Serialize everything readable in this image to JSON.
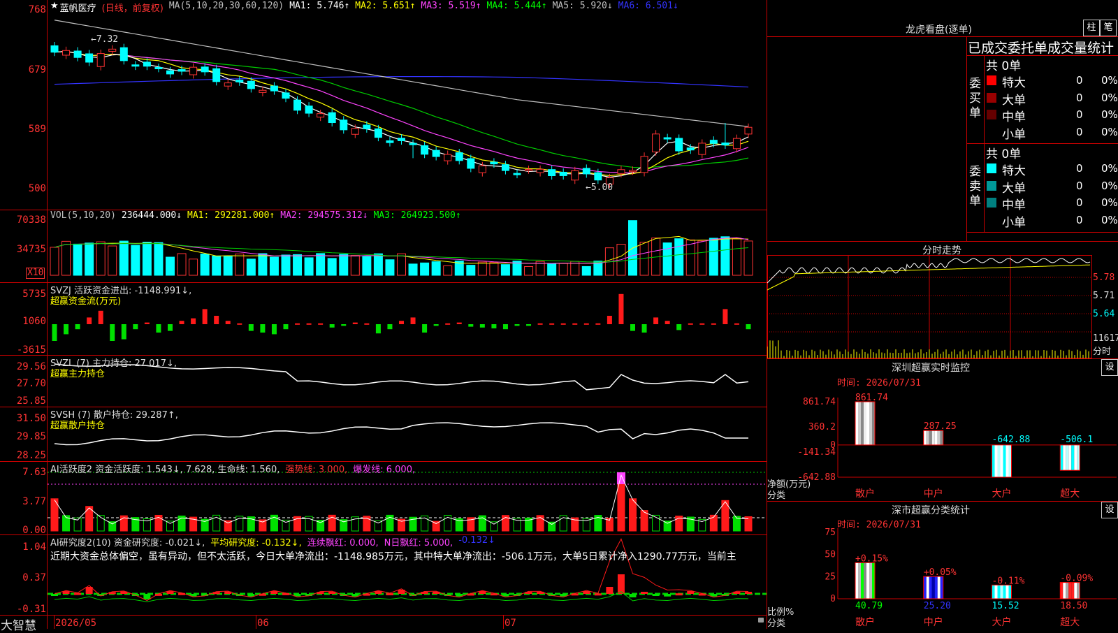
{
  "app": {
    "brand": "大智慧"
  },
  "kline": {
    "star": "★",
    "name": "蓝帆医疗",
    "period": "(日线，前复权)",
    "ma_params": "MA(5,10,20,30,60,120)",
    "ma1": "MA1: 5.746↑",
    "ma2": "MA2: 5.651↑",
    "ma3": "MA3: 5.519↑",
    "ma4": "MA4: 5.444↑",
    "ma5": "MA5: 5.920↓",
    "ma6": "MA6: 6.501↓",
    "y_ticks": [
      "768",
      "679",
      "589",
      "500"
    ],
    "high_label": "←7.32",
    "low_label": "←5.00",
    "colors": {
      "up": "#ff3333",
      "down": "#00ffff",
      "ma1": "#ffffff",
      "ma2": "#ffff00",
      "ma3": "#ff44ff",
      "ma4": "#00cc00",
      "ma5": "#c0c0c0",
      "ma6": "#3333ff"
    }
  },
  "vol": {
    "params": "VOL(5,10,20)",
    "value": "236444.000↓",
    "ma1": "MA1: 292281.000↑",
    "ma2": "MA2: 294575.312↓",
    "ma3": "MA3: 264923.500↑",
    "y_ticks": [
      "70338",
      "34735"
    ],
    "unit": "X10"
  },
  "svzj": {
    "title": "SVZJ  活跃资金进出: -1148.991↓,",
    "sub": "超赢资金流(万元)",
    "y_ticks": [
      "5735",
      "1060",
      "-3615"
    ]
  },
  "svzl": {
    "title": "SVZL (7) 主力持仓: 27.017↓,",
    "sub": "超赢主力持仓",
    "y_ticks": [
      "29.56",
      "27.70",
      "25.85"
    ]
  },
  "svsh": {
    "title": "SVSH (7) 散户持仓: 29.287↑,",
    "sub": "超赢散户持仓",
    "y_ticks": [
      "31.50",
      "29.85",
      "28.25"
    ]
  },
  "ai_active": {
    "t1": "AI活跃度2 资金活跃度: 1.543↓, 7.628, 生命线: 1.560,",
    "t2": "强势线: 3.000,",
    "t3": "爆发线: 6.000,",
    "y_ticks": [
      "7.63",
      "3.77",
      "0.00"
    ]
  },
  "ai_research": {
    "t1": "AI研究度2(10) 资金研究度: -0.021↓,",
    "t2": "平均研究度: -0.132↓,",
    "t3": "连续飘红: 0.000,",
    "t4": "N日飘红: 5.000,",
    "t5": "-0.132↓",
    "comment": "近期大资金总体偏空，虽有异动，但不太活跃，今日大单净流出：-1148.985万元，其中特大单净流出：-506.1万元，大单5日累计净入1290.77万元，当前主",
    "y_ticks": [
      "1.04",
      "0.37",
      "-0.31"
    ]
  },
  "date_axis": [
    "2026/05",
    "06",
    "07"
  ],
  "dragon": {
    "title": "龙虎看盘(逐单)",
    "btn1": "柱",
    "btn2": "笔",
    "header": "已成交委托单成交量统计",
    "buy_label": "委买单",
    "sell_label": "委卖单",
    "buy_total": "共 0单",
    "sell_total": "共 0单",
    "buy_rows": [
      {
        "name": "特大",
        "count": "0",
        "pct": "0%",
        "color": "#ff0000"
      },
      {
        "name": "大单",
        "count": "0",
        "pct": "0%",
        "color": "#990000"
      },
      {
        "name": "中单",
        "count": "0",
        "pct": "0%",
        "color": "#660000"
      },
      {
        "name": "小单",
        "count": "0",
        "pct": "0%",
        "color": ""
      }
    ],
    "sell_rows": [
      {
        "name": "特大",
        "count": "0",
        "pct": "0%",
        "color": "#00ffff"
      },
      {
        "name": "大单",
        "count": "0",
        "pct": "0%",
        "color": "#009999"
      },
      {
        "name": "中单",
        "count": "0",
        "pct": "0%",
        "color": "#008080"
      },
      {
        "name": "小单",
        "count": "0",
        "pct": "0%",
        "color": ""
      }
    ]
  },
  "intraday": {
    "title": "分时走势",
    "y_ticks": [
      "5.78",
      "5.71",
      "5.64"
    ],
    "vol_label": "11617",
    "fen_label": "分时"
  },
  "monitor": {
    "title": "深圳超赢实时监控",
    "set": "设",
    "time": "时间: 2026/07/31",
    "y_ticks": [
      "861.74",
      "360.2",
      "0",
      "-141.34",
      "-642.88"
    ],
    "unit": "净额(万元)",
    "cat_label": "分类",
    "chart_data": {
      "type": "bar",
      "categories": [
        "散户",
        "中户",
        "大户",
        "超大"
      ],
      "values": [
        861.74,
        287.25,
        -642.88,
        -506.1
      ],
      "value_labels": [
        "861.74",
        "287.25",
        "-642.88",
        "-506.1"
      ],
      "ylabel": "净额(万元)",
      "ylim": [
        -642.88,
        861.74
      ]
    }
  },
  "classify": {
    "title": "深市超赢分类统计",
    "set": "设",
    "time": "时间: 2026/07/31",
    "y_ticks": [
      "75",
      "50",
      "25",
      "0"
    ],
    "unit": "比例%",
    "cat_label": "分类",
    "chart_data": {
      "type": "bar",
      "categories": [
        "散户",
        "中户",
        "大户",
        "超大"
      ],
      "values": [
        40.79,
        25.2,
        15.52,
        18.5
      ],
      "value_labels": [
        "40.79",
        "25.20",
        "15.52",
        "18.50"
      ],
      "changes": [
        "+0.15%",
        "+0.05%",
        "-0.11%",
        "-0.09%"
      ],
      "ylabel": "比例%",
      "ylim": [
        0,
        75
      ]
    }
  }
}
